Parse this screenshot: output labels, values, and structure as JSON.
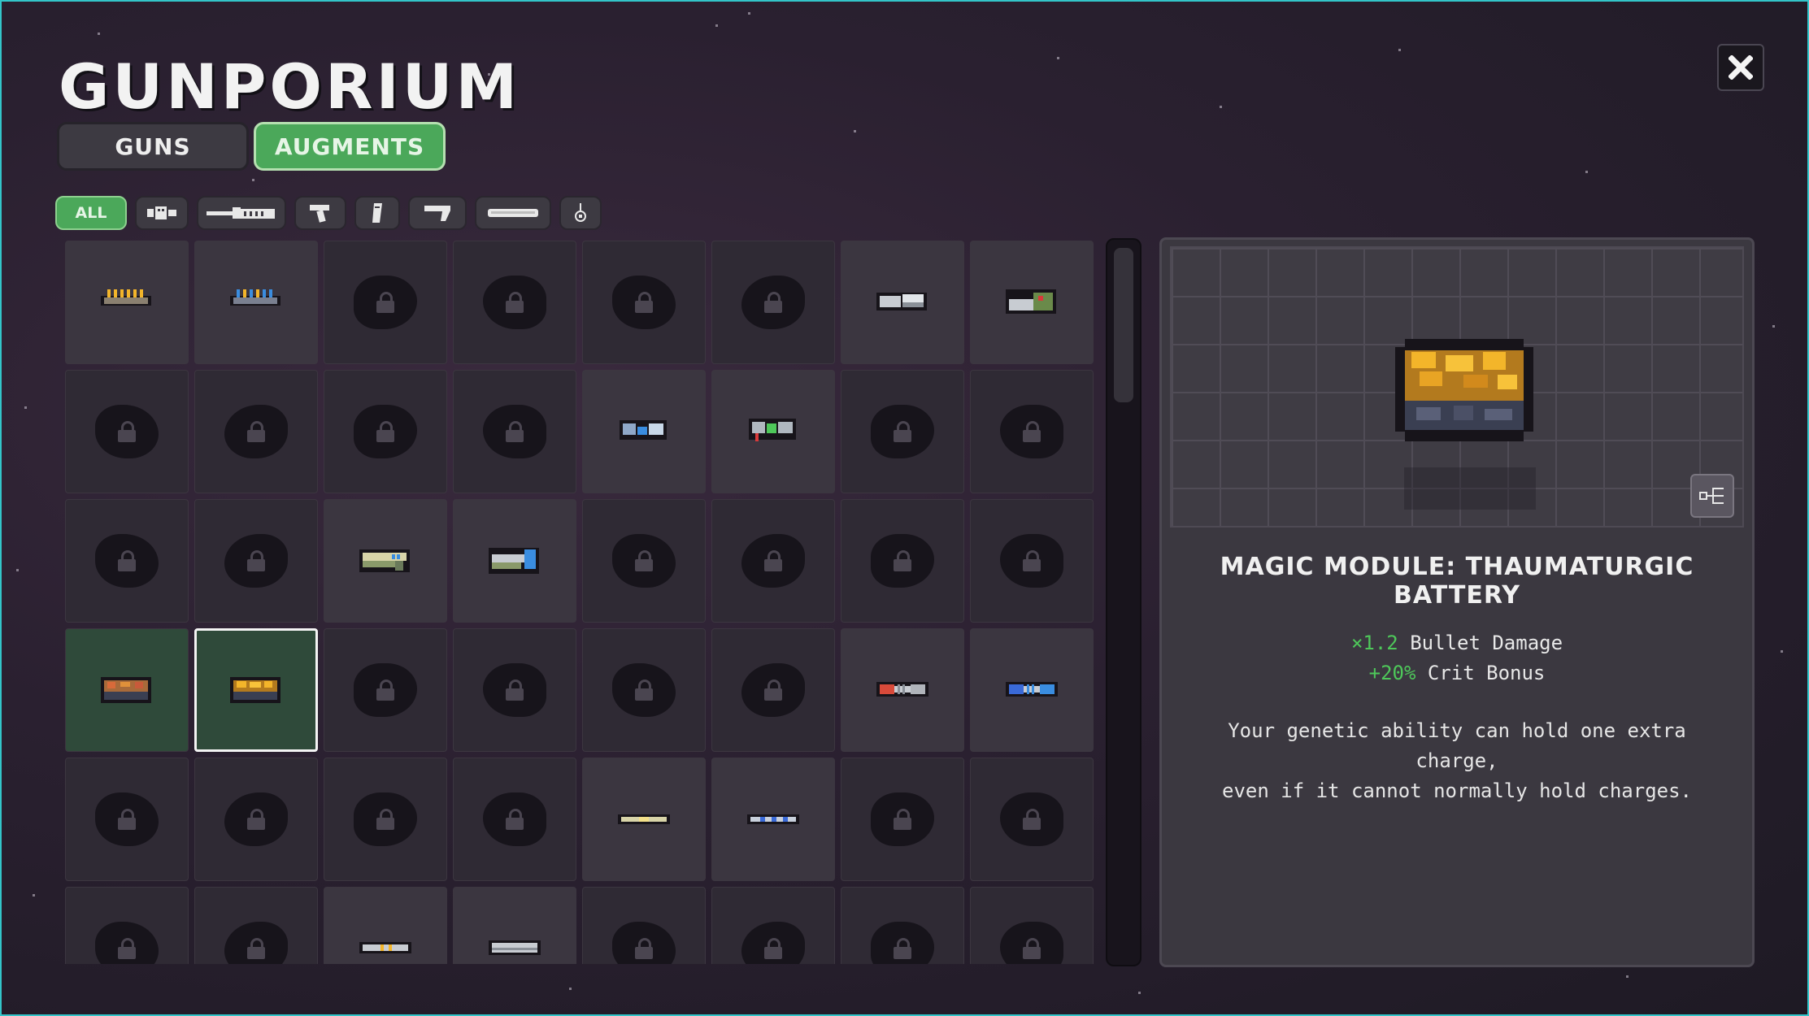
{
  "title": "GUNPORIUM",
  "tabs": {
    "guns": "GUNS",
    "augments": "AUGMENTS",
    "active": "augments"
  },
  "filters": [
    {
      "label": "ALL",
      "icon": "all",
      "active": true
    },
    {
      "icon": "muzzle-filter-icon"
    },
    {
      "icon": "barrel-filter-icon"
    },
    {
      "icon": "grip-filter-icon"
    },
    {
      "icon": "magazine-filter-icon"
    },
    {
      "icon": "stock-filter-icon"
    },
    {
      "icon": "scope-filter-icon"
    },
    {
      "icon": "charm-filter-icon"
    }
  ],
  "grid": [
    {
      "state": "unlocked",
      "icon": "gold-rail"
    },
    {
      "state": "unlocked",
      "icon": "blue-rail"
    },
    {
      "state": "locked"
    },
    {
      "state": "locked"
    },
    {
      "state": "locked"
    },
    {
      "state": "locked"
    },
    {
      "state": "unlocked",
      "icon": "grey-mount"
    },
    {
      "state": "unlocked",
      "icon": "green-mount"
    },
    {
      "state": "locked"
    },
    {
      "state": "locked"
    },
    {
      "state": "locked"
    },
    {
      "state": "locked"
    },
    {
      "state": "unlocked",
      "icon": "blue-wing"
    },
    {
      "state": "unlocked",
      "icon": "green-wing"
    },
    {
      "state": "locked"
    },
    {
      "state": "locked"
    },
    {
      "state": "locked"
    },
    {
      "state": "locked"
    },
    {
      "state": "unlocked",
      "icon": "yellow-barrel"
    },
    {
      "state": "unlocked",
      "icon": "blue-barrel"
    },
    {
      "state": "locked"
    },
    {
      "state": "locked"
    },
    {
      "state": "locked"
    },
    {
      "state": "locked"
    },
    {
      "state": "owned",
      "icon": "red-battery"
    },
    {
      "state": "selected",
      "icon": "gold-battery"
    },
    {
      "state": "locked"
    },
    {
      "state": "locked"
    },
    {
      "state": "locked"
    },
    {
      "state": "locked"
    },
    {
      "state": "unlocked",
      "icon": "red-coil"
    },
    {
      "state": "unlocked",
      "icon": "blue-coil"
    },
    {
      "state": "locked"
    },
    {
      "state": "locked"
    },
    {
      "state": "locked"
    },
    {
      "state": "locked"
    },
    {
      "state": "unlocked",
      "icon": "yellow-rod"
    },
    {
      "state": "unlocked",
      "icon": "blue-rod"
    },
    {
      "state": "locked"
    },
    {
      "state": "locked"
    },
    {
      "state": "locked"
    },
    {
      "state": "locked"
    },
    {
      "state": "unlocked",
      "icon": "silver-rod"
    },
    {
      "state": "unlocked",
      "icon": "silver-rod-2"
    },
    {
      "state": "locked"
    },
    {
      "state": "locked"
    },
    {
      "state": "locked"
    },
    {
      "state": "locked"
    }
  ],
  "scroll": {
    "position": 0
  },
  "detail": {
    "name": "MAGIC MODULE: THAUMATURGIC BATTERY",
    "preview_icon": "gold-battery",
    "stats": [
      {
        "value": "×1.2",
        "label": "Bullet Damage"
      },
      {
        "value": "+20%",
        "label": "Crit Bonus"
      }
    ],
    "description_1": "Your genetic ability can hold one extra charge,",
    "description_2": "even if it cannot normally hold charges.",
    "tree_button_icon": "upgrade-tree-icon"
  },
  "close_icon": "close-icon",
  "colors": {
    "accent": "#4ba85a",
    "frame": "#33c5c9",
    "stat_green": "#4ec85a"
  }
}
